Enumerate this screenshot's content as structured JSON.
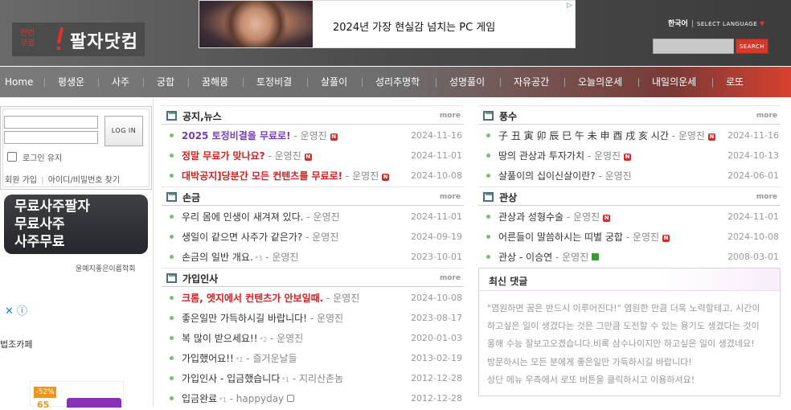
{
  "header": {
    "logo_small_line1": "한번",
    "logo_small_line2": "무료",
    "logo_text": "팔자닷컴",
    "ad_text": "2024년 가장 현실감 넘치는 PC 게임",
    "ad_choice": "▷",
    "lang_current": "한국어",
    "lang_select": "SELECT LANGUAGE",
    "search_button": "SEARCH"
  },
  "nav": [
    "Home",
    "평생운",
    "사주",
    "궁합",
    "꿈해몽",
    "토정비결",
    "살풀이",
    "성리추명학",
    "성명풀이",
    "자유공간",
    "오늘의운세",
    "내일의운세",
    "로또"
  ],
  "login": {
    "login_button": "LOG IN",
    "keep_label": "로그인 유지",
    "join": "회원 가입",
    "find": "아이디/비밀번호 찾기",
    "sep": "|"
  },
  "promo": {
    "lines": [
      "무료사주팔자",
      "무료사주",
      "사주무료"
    ],
    "credit": "윤예지좋은이름학회"
  },
  "sidebar": {
    "ad_icons": "✕ ⓘ",
    "cafe": "법조카페",
    "shop_badge": "-52%",
    "shop_price": "65"
  },
  "panels": {
    "notice": {
      "title": "공지,뉴스",
      "more": "more",
      "rows": [
        {
          "title": "2025 토정비결을 무료로!",
          "author": "운영진",
          "date": "2024-11-16"
        },
        {
          "title": "정말 무료가 맞나요?",
          "author": "운영진",
          "date": "2024-11-01"
        },
        {
          "title": "대박공지]당분간 모든 컨텐츠를 무료로!",
          "author": "운영진",
          "date": "2024-10-08"
        }
      ]
    },
    "hand": {
      "title": "손금",
      "more": "more",
      "rows": [
        {
          "title": "우리 몸에 인생이 새겨져 있다.",
          "author": "운영진",
          "date": "2024-11-01"
        },
        {
          "title": "생일이 같으면 사주가 같은가?",
          "author": "운영진",
          "date": "2024-09-19"
        },
        {
          "title": "손금의 일반 개요.",
          "count": "3",
          "author": "운영진",
          "date": "2023-10-01"
        }
      ]
    },
    "greet": {
      "title": "가입인사",
      "more": "more",
      "rows": [
        {
          "title": "크롬, 엣지에서 컨텐츠가 안보일때.",
          "author": "운영진",
          "date": "2024-10-08"
        },
        {
          "title": "좋은일만 가득하시길 바랍니다!",
          "author": "운영진",
          "date": "2023-08-17"
        },
        {
          "title": "복 많이 받으세요!!",
          "count": "2",
          "author": "운영진",
          "date": "2020-01-03"
        },
        {
          "title": "가입했어요!!",
          "count": "1",
          "author": "즐거운날들",
          "date": "2013-02-19"
        },
        {
          "title": "가입인사 - 입금했습니다",
          "count": "1",
          "author": "지리산촌놈",
          "date": "2012-12-28"
        },
        {
          "title": "입금완료",
          "count": "1",
          "author": "happyday",
          "date": "2012-12-28"
        }
      ]
    },
    "fengshui": {
      "title": "풍수",
      "more": "more",
      "rows": [
        {
          "title": "子 丑 寅 卯 辰 巳 午 未 申 酉 戌 亥 시간",
          "author": "운영진",
          "date": "2024-11-16"
        },
        {
          "title": "땅의 관상과 투자가치",
          "author": "운영진",
          "date": "2024-10-13"
        },
        {
          "title": "살풀이의 십이신살이란?",
          "author": "운영진",
          "date": "2024-06-01"
        }
      ]
    },
    "physio": {
      "title": "관상",
      "more": "more",
      "rows": [
        {
          "title": "관상과 성형수술",
          "author": "운영진",
          "date": "2024-11-01"
        },
        {
          "title": "어른들이 말씀하시는 띠별 궁합",
          "author": "운영진",
          "date": "2024-10-08"
        },
        {
          "title": "관상 - 이승연",
          "author": "운영진",
          "date": "2008-03-01"
        }
      ]
    },
    "comments": {
      "title": "최신 댓글",
      "lines": [
        "\"염원하면 꿈은 반드시 이루어진다!\" 염원한 만큼 더욱 노력할테고, 시간이",
        "하고싶은 일이 생겼다는 것은 그만큼 도전할 수 있는 용기도 생겼다는 것이",
        "올해 수능 잘보고오겠습니다.비록 삼수나이지만 하고싶은 일이 생겼네요!",
        "방문하시는 모든 분에게 좋은일만 가득하시길 바랍니다!",
        "상단 메뉴 우측에서 로또 버튼을 클릭하시고 이용하셔요!"
      ]
    }
  },
  "colors": {
    "nav_accent": "#d9402f",
    "bullet": "#7bbf6a",
    "new_badge": "#d62a2a"
  }
}
